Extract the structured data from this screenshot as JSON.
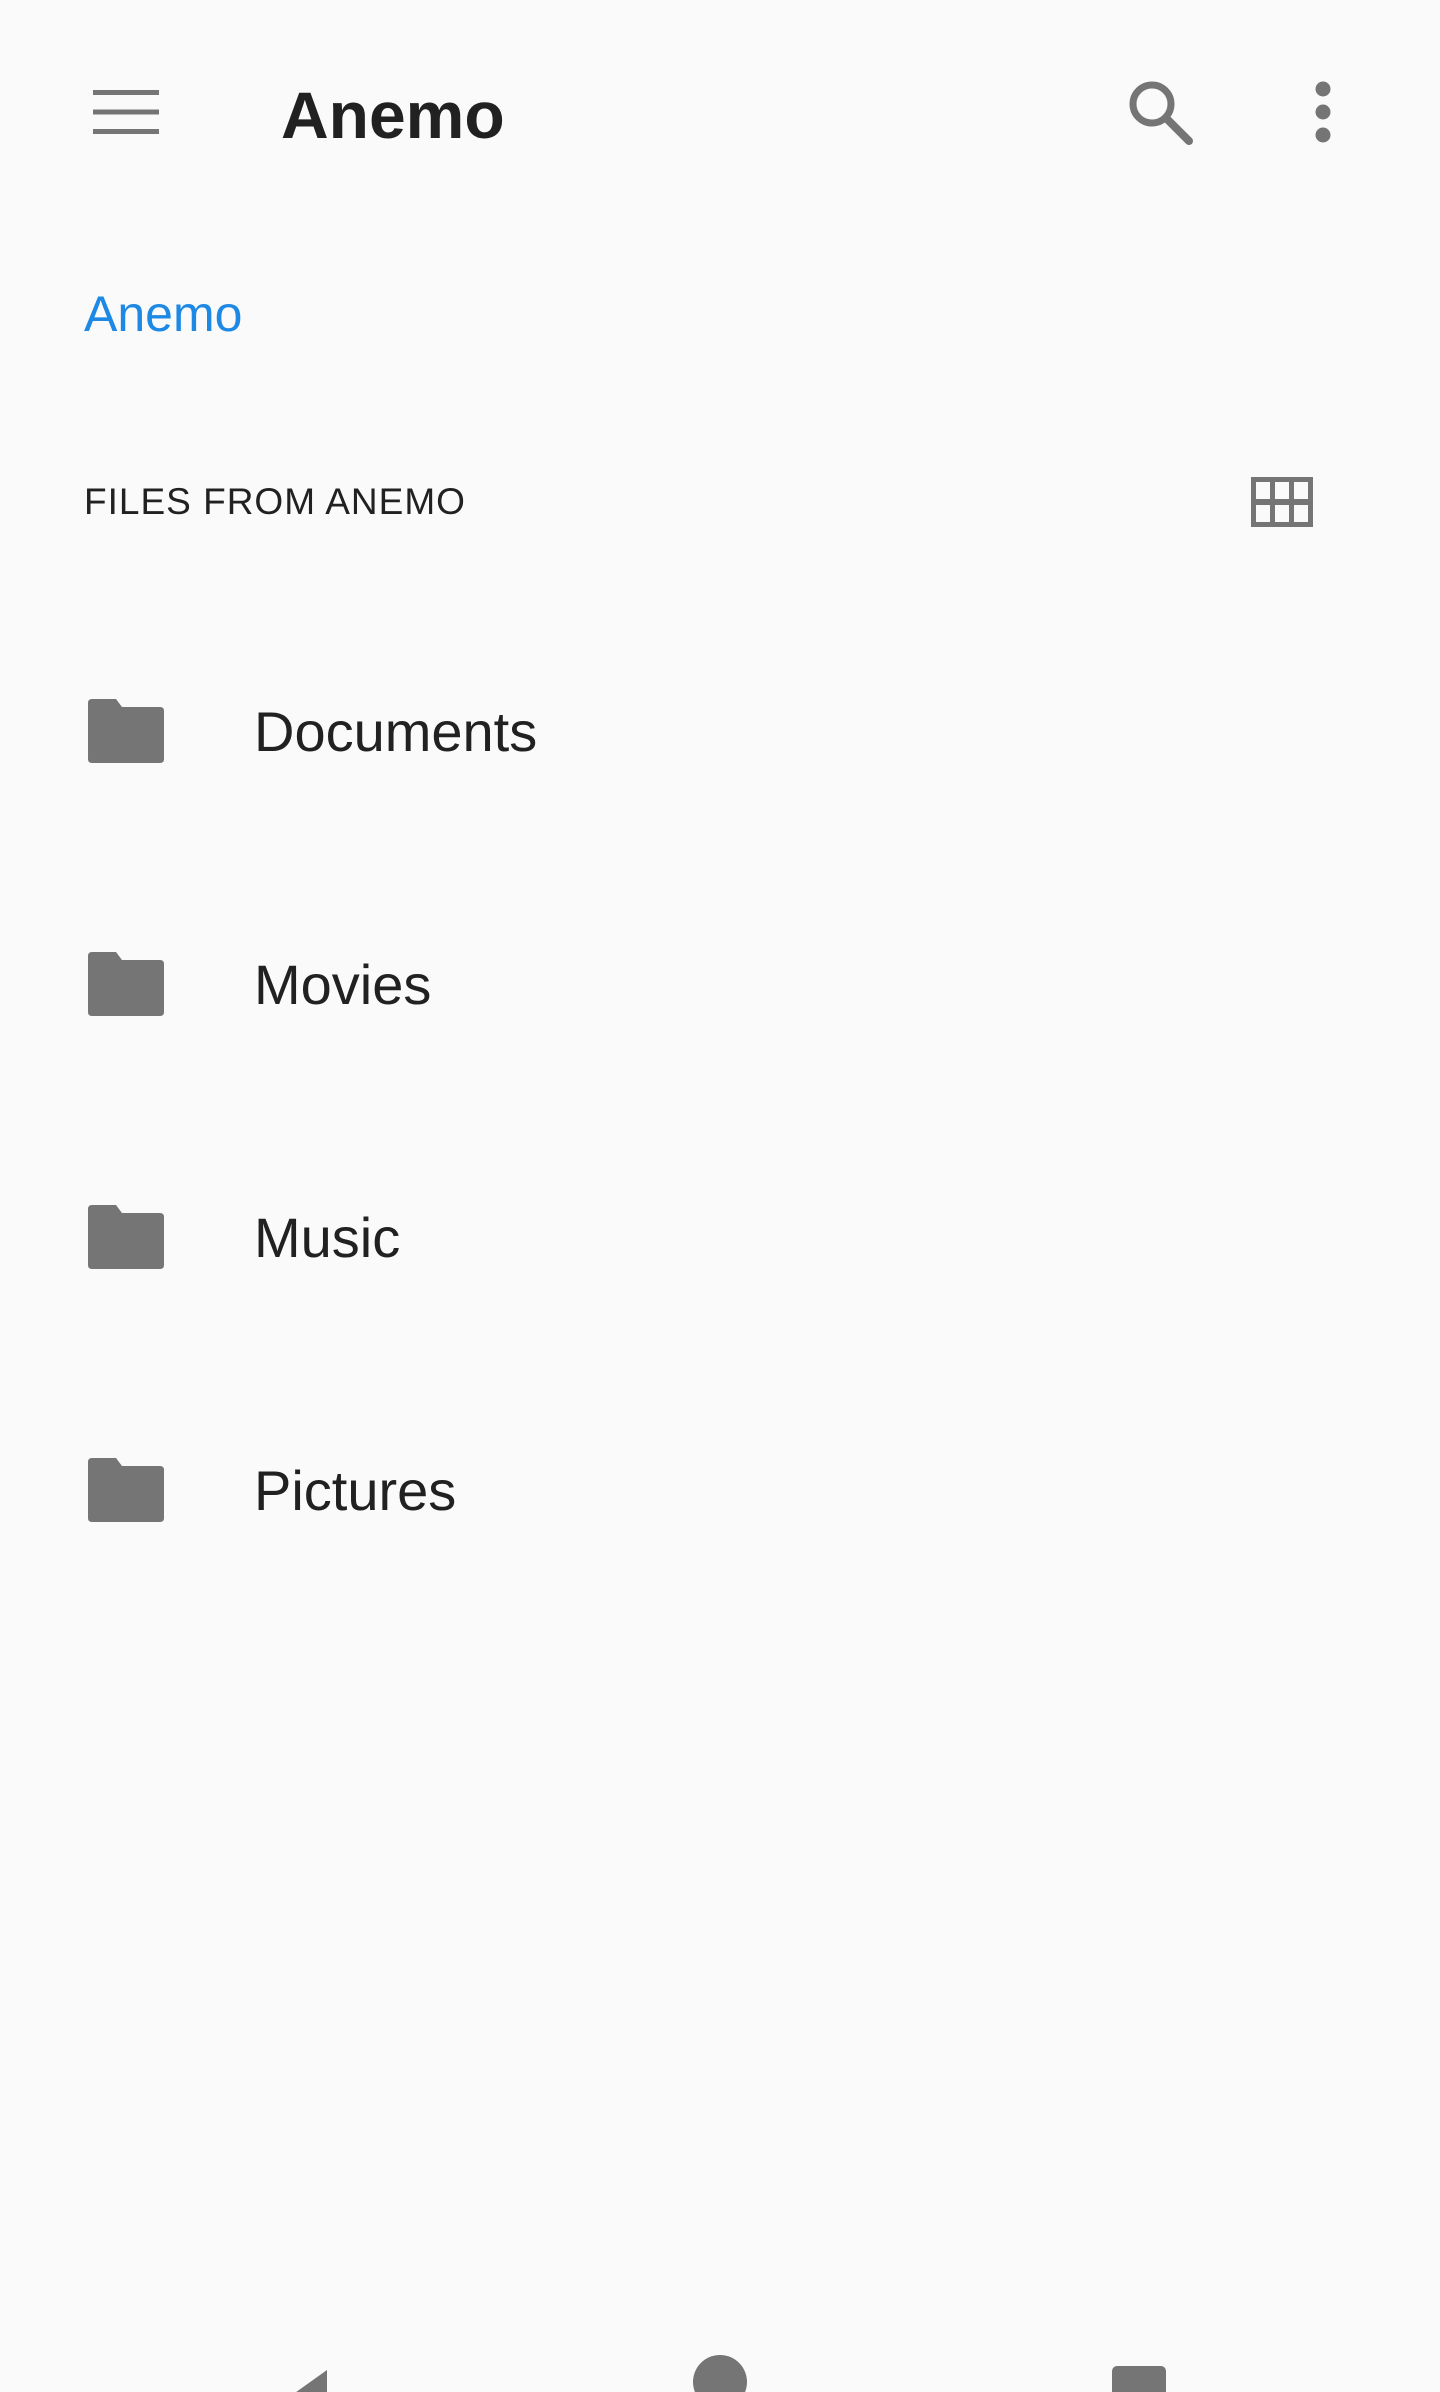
{
  "app_bar": {
    "title": "Anemo",
    "menu_icon": "hamburger-menu-icon",
    "search_icon": "search-icon",
    "more_icon": "more-vertical-icon"
  },
  "breadcrumb": {
    "root": "Anemo"
  },
  "section": {
    "header": "FILES FROM ANEMO",
    "view_toggle_icon": "grid-view-icon"
  },
  "files": [
    {
      "name": "Documents",
      "icon": "folder-icon"
    },
    {
      "name": "Movies",
      "icon": "folder-icon"
    },
    {
      "name": "Music",
      "icon": "folder-icon"
    },
    {
      "name": "Pictures",
      "icon": "folder-icon"
    }
  ],
  "nav_bar": {
    "back_icon": "back-triangle-icon",
    "home_icon": "home-circle-icon",
    "recents_icon": "recents-square-icon"
  },
  "colors": {
    "accent": "#1e88e5",
    "icon_gray": "#757575",
    "text": "#212121",
    "background": "#fafafa"
  }
}
